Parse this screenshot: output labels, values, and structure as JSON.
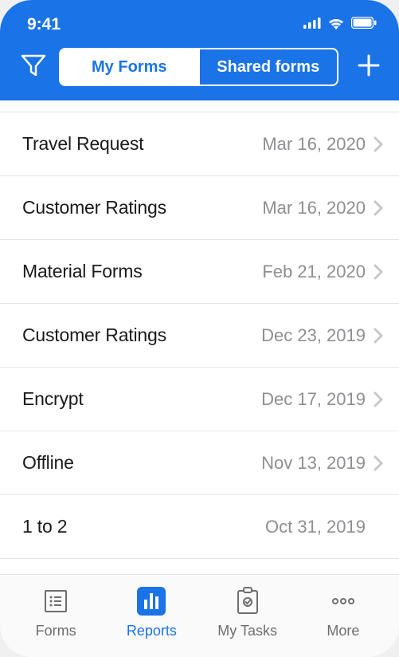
{
  "status": {
    "time": "9:41"
  },
  "tabs": {
    "my": "My Forms",
    "shared": "Shared forms"
  },
  "list": [
    {
      "title": "Travel Request",
      "date": "Mar 16, 2020",
      "hasChevron": true
    },
    {
      "title": "Customer Ratings",
      "date": "Mar 16, 2020",
      "hasChevron": true
    },
    {
      "title": "Material Forms",
      "date": "Feb 21, 2020",
      "hasChevron": true
    },
    {
      "title": "Customer Ratings",
      "date": "Dec 23, 2019",
      "hasChevron": true
    },
    {
      "title": "Encrypt",
      "date": "Dec 17, 2019",
      "hasChevron": true
    },
    {
      "title": "Offline",
      "date": "Nov 13, 2019",
      "hasChevron": true
    },
    {
      "title": "1 to 2",
      "date": "Oct 31, 2019",
      "hasChevron": false
    }
  ],
  "bottomTabs": {
    "forms": "Forms",
    "reports": "Reports",
    "mytasks": "My Tasks",
    "more": "More"
  }
}
